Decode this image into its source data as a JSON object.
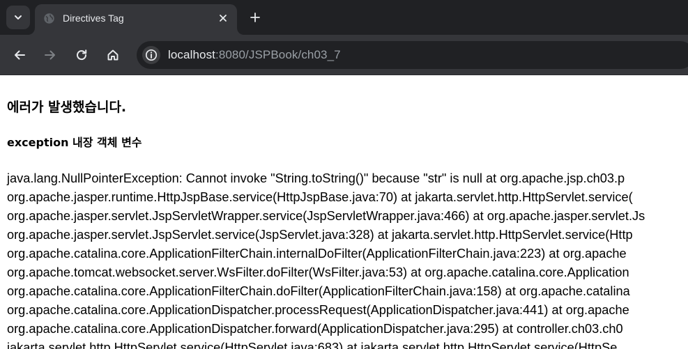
{
  "browser": {
    "tab": {
      "title": "Directives Tag",
      "favicon": "globe-icon"
    },
    "url": {
      "host": "localhost",
      "path": ":8080/JSPBook/ch03_7"
    },
    "colors": {
      "chrome_dark": "#202124",
      "chrome_mid": "#35363a",
      "text": "#e8eaed",
      "muted": "#9aa0a6"
    }
  },
  "page": {
    "heading": "에러가 발생했습니다.",
    "subheading": "exception 내장 객체 변수",
    "stack_trace": [
      "java.lang.NullPointerException: Cannot invoke \"String.toString()\" because \"str\" is null at org.apache.jsp.ch03.p",
      "org.apache.jasper.runtime.HttpJspBase.service(HttpJspBase.java:70) at jakarta.servlet.http.HttpServlet.service(",
      "org.apache.jasper.servlet.JspServletWrapper.service(JspServletWrapper.java:466) at org.apache.jasper.servlet.Js",
      "org.apache.jasper.servlet.JspServlet.service(JspServlet.java:328) at jakarta.servlet.http.HttpServlet.service(Http",
      "org.apache.catalina.core.ApplicationFilterChain.internalDoFilter(ApplicationFilterChain.java:223) at org.apache",
      "org.apache.tomcat.websocket.server.WsFilter.doFilter(WsFilter.java:53) at org.apache.catalina.core.Application",
      "org.apache.catalina.core.ApplicationFilterChain.doFilter(ApplicationFilterChain.java:158) at org.apache.catalina",
      "org.apache.catalina.core.ApplicationDispatcher.processRequest(ApplicationDispatcher.java:441) at org.apache",
      "org.apache.catalina.core.ApplicationDispatcher.forward(ApplicationDispatcher.java:295) at controller.ch03.ch0",
      "jakarta.servlet.http.HttpServlet.service(HttpServlet.java:683) at jakarta.servlet.http.HttpServlet.service(HttpSe"
    ]
  }
}
